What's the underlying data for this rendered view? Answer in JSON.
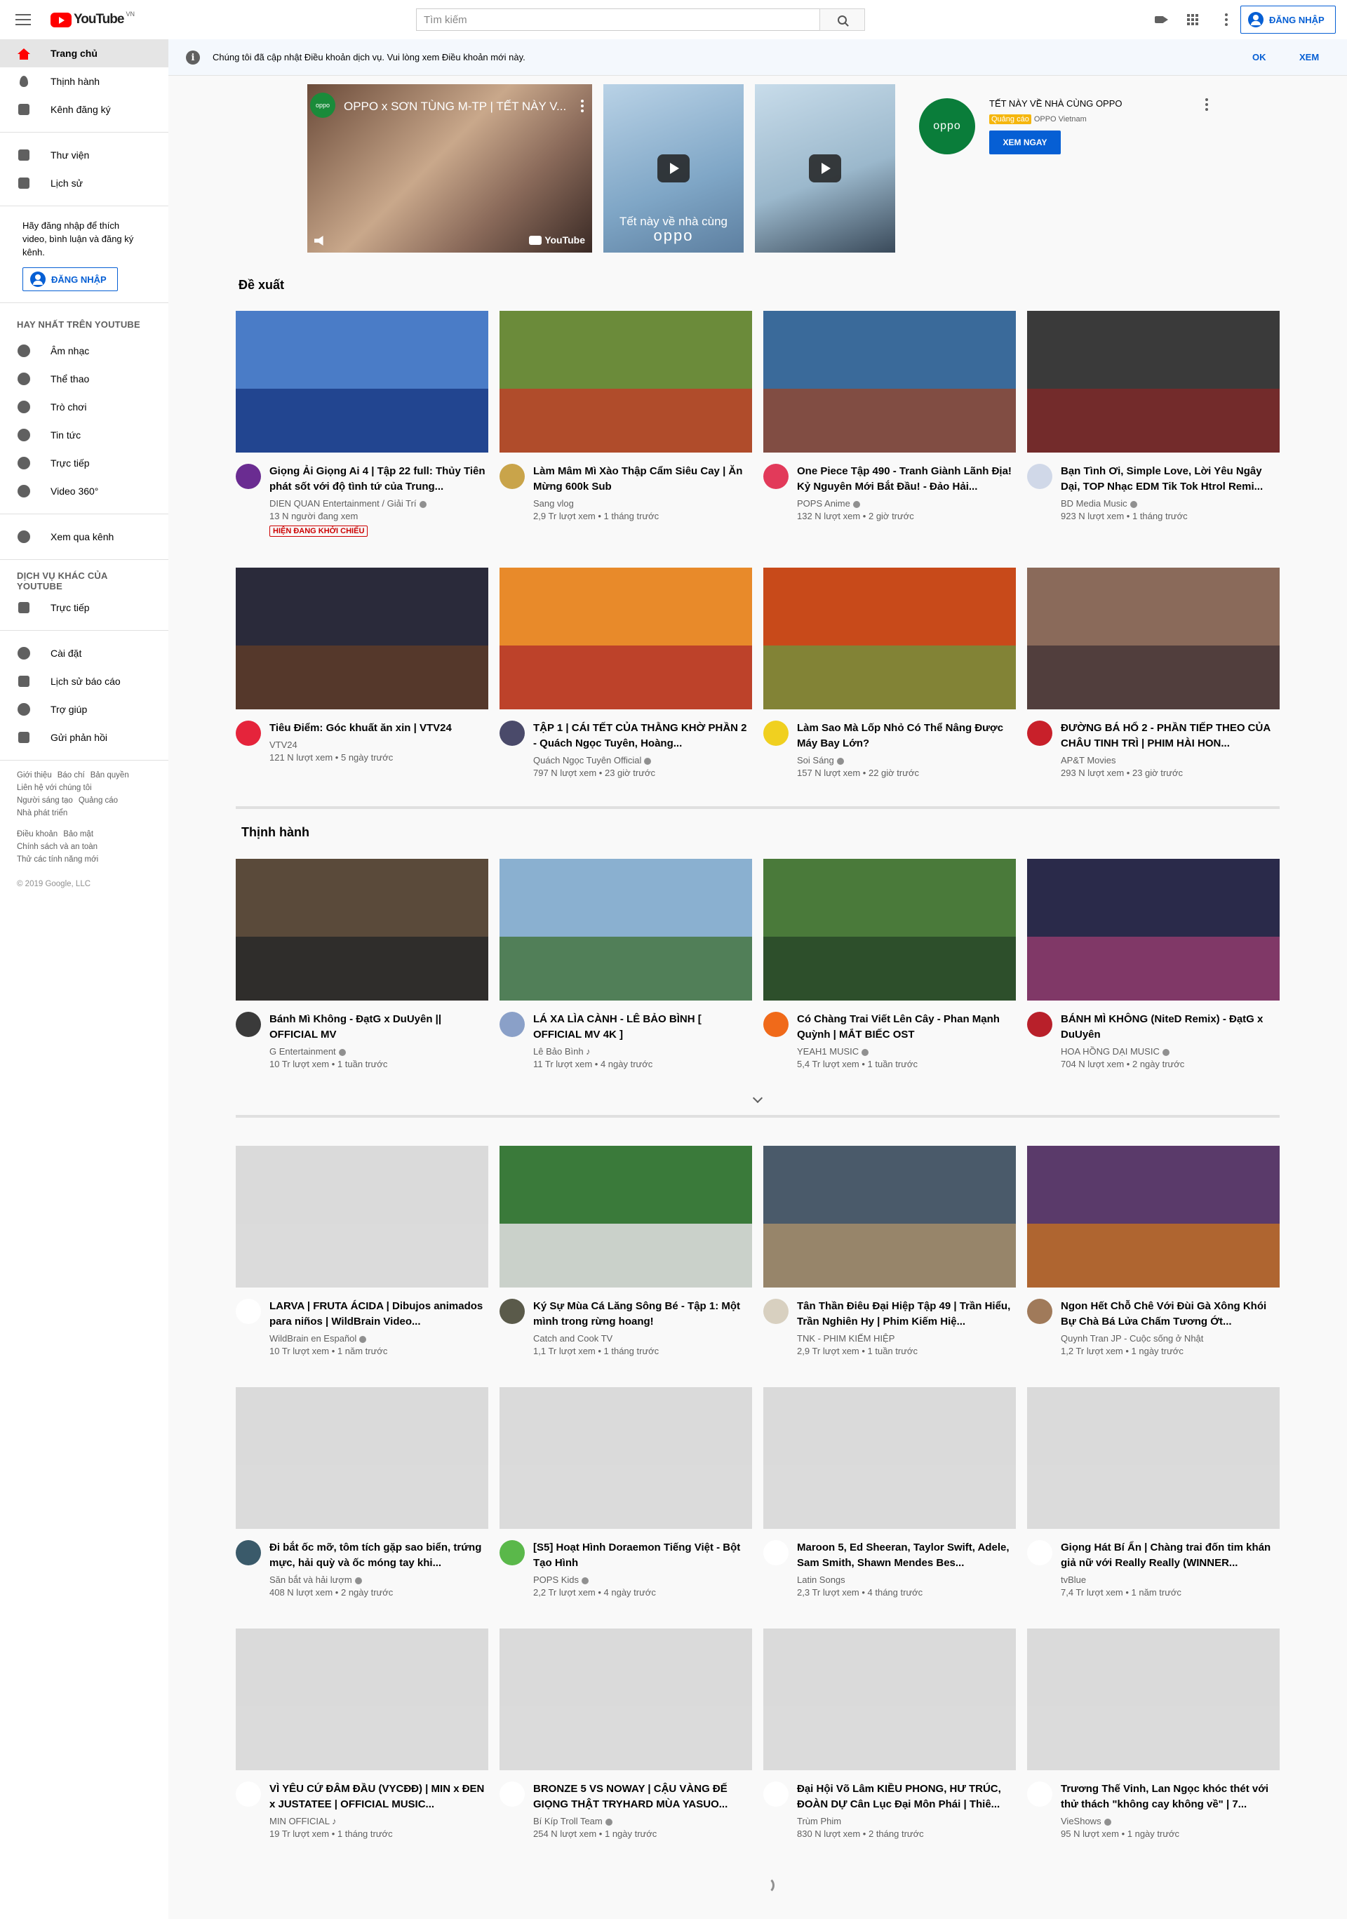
{
  "header": {
    "logo_word": "YouTube",
    "logo_region": "VN",
    "search_placeholder": "Tìm kiếm",
    "sign_in_label": "ĐĂNG NHẬP",
    "icons": [
      "menu-icon",
      "search-icon",
      "create-video-icon",
      "apps-icon",
      "settings-more-icon",
      "account-icon"
    ]
  },
  "sidebar": {
    "main_items": [
      {
        "label": "Trang chủ",
        "icon": "home-icon",
        "active": true
      },
      {
        "label": "Thịnh hành",
        "icon": "trending-icon"
      },
      {
        "label": "Kênh đăng ký",
        "icon": "subscriptions-icon"
      }
    ],
    "library_items": [
      {
        "label": "Thư viện",
        "icon": "library-icon"
      },
      {
        "label": "Lịch sử",
        "icon": "history-icon"
      }
    ],
    "signin_prompt": "Hãy đăng nhập để thích video, bình luận và đăng ký kênh.",
    "signin_label": "ĐĂNG NHẬP",
    "best_heading": "HAY NHẤT TRÊN YOUTUBE",
    "best_items": [
      {
        "label": "Âm nhạc",
        "icon": "music-icon"
      },
      {
        "label": "Thể thao",
        "icon": "sports-icon"
      },
      {
        "label": "Trò chơi",
        "icon": "gaming-icon"
      },
      {
        "label": "Tin tức",
        "icon": "news-icon"
      },
      {
        "label": "Trực tiếp",
        "icon": "live-icon"
      },
      {
        "label": "Video 360°",
        "icon": "video-360-icon"
      }
    ],
    "browse_channels": {
      "label": "Xem qua kênh",
      "icon": "add-circle-icon"
    },
    "more_heading": "DỊCH VỤ KHÁC CỦA YOUTUBE",
    "more_items": [
      {
        "label": "Trực tiếp",
        "icon": "broadcast-icon"
      }
    ],
    "settings_items": [
      {
        "label": "Cài đặt",
        "icon": "settings-icon"
      },
      {
        "label": "Lịch sử báo cáo",
        "icon": "flag-icon"
      },
      {
        "label": "Trợ giúp",
        "icon": "help-icon"
      },
      {
        "label": "Gửi phản hồi",
        "icon": "feedback-icon"
      }
    ],
    "footer_rows_1": [
      [
        "Giới thiệu",
        "Báo chí",
        "Bản quyền"
      ],
      [
        "Liên hệ với chúng tôi"
      ],
      [
        "Người sáng tạo",
        "Quảng cáo"
      ],
      [
        "Nhà phát triển"
      ]
    ],
    "footer_rows_2": [
      [
        "Điều khoản",
        "Bảo mật"
      ],
      [
        "Chính sách và an toàn"
      ],
      [
        "Thử các tính năng mới"
      ]
    ],
    "copyright": "© 2019 Google, LLC"
  },
  "banner": {
    "message": "Chúng tôi đã cập nhật Điều khoản dịch vụ. Vui lòng xem Điều khoản mới này.",
    "ok_label": "OK",
    "view_label": "XEM"
  },
  "ad": {
    "channel_logo_text": "oppo",
    "video_title": "OPPO x SƠN TÙNG M-TP | TẾT NÀY V...",
    "youtube_watermark": "YouTube",
    "thumb2_caption_1": "Tết này về nhà cùng",
    "thumb2_caption_2": "oppo",
    "brand_logo_text": "oppo",
    "title": "TẾT NÀY VỀ NHÀ CÙNG OPPO",
    "ad_badge": "Quảng cáo",
    "advertiser": "OPPO Vietnam",
    "cta_label": "XEM NGAY"
  },
  "sections": {
    "recommended_title": "Đề xuất",
    "trending_title": "Thịnh hành"
  },
  "recommended": [
    {
      "title": "Giọng Ải Giọng Ai 4 | Tập 22 full: Thủy Tiên phát sốt với độ tình tứ của Trung...",
      "channel": "DIEN QUAN Entertainment / Giải Trí",
      "verified": true,
      "stats": "13 N người đang xem",
      "badge": "HIỆN ĐANG KHỞI CHIẾU",
      "avatar": "#6a2c91",
      "thumb": [
        "#4a7cc7",
        "#1e3f8a"
      ]
    },
    {
      "title": "Làm Mâm Mì Xào Thập Cẩm Siêu Cay | Ăn Mừng 600k Sub",
      "channel": "Sang vlog",
      "verified": false,
      "stats": "2,9 Tr lượt xem • 1 tháng trước",
      "avatar": "#c9a44a",
      "thumb": [
        "#6b8b3a",
        "#b8452a"
      ]
    },
    {
      "title": "One Piece Tập 490 - Tranh Giành Lãnh Địa! Kỷ Nguyên Mới Bắt Đầu! - Đảo Hải...",
      "channel": "POPS Anime",
      "verified": true,
      "stats": "132 N lượt xem • 2 giờ trước",
      "avatar": "#e23a5a",
      "thumb": [
        "#3a6a9a",
        "#8a4a3a"
      ]
    },
    {
      "title": "Bạn Tình Ơi, Simple Love, Lời Yêu Ngây Dại, TOP Nhạc EDM Tik Tok Htrol Remi...",
      "channel": "BD Media Music",
      "verified": true,
      "stats": "923 N lượt xem • 1 tháng trước",
      "avatar": "#d0d8e8",
      "thumb": [
        "#3a3a3a",
        "#7a2a2a"
      ]
    },
    {
      "title": "Tiêu Điểm: Góc khuất ăn xin | VTV24",
      "channel": "VTV24",
      "verified": false,
      "stats": "121 N lượt xem • 5 ngày trước",
      "avatar": "#e5243b",
      "thumb": [
        "#2a2a3a",
        "#5a3a2a"
      ]
    },
    {
      "title": "TẬP 1 | CÁI TẾT CỦA THẰNG KHỜ PHẦN 2 - Quách Ngọc Tuyên, Hoàng...",
      "channel": "Quách Ngọc Tuyên Official",
      "verified": true,
      "stats": "797 N lượt xem • 23 giờ trước",
      "avatar": "#4a4a6a",
      "thumb": [
        "#e88a2a",
        "#b83a2a"
      ]
    },
    {
      "title": "Làm Sao Mà Lốp Nhỏ Có Thể Nâng Được Máy Bay Lớn?",
      "channel": "Soi Sáng",
      "verified": true,
      "stats": "157 N lượt xem • 22 giờ trước",
      "avatar": "#f0d020",
      "thumb": [
        "#c84a1a",
        "#7a8a3a"
      ]
    },
    {
      "title": "ĐƯỜNG BÁ HỔ 2 - PHẦN TIẾP THEO CỦA CHÂU TINH TRÌ | PHIM HÀI HON...",
      "channel": "AP&T Movies",
      "verified": false,
      "stats": "293 N lượt xem • 23 giờ trước",
      "avatar": "#c8202a",
      "thumb": [
        "#8a6a5a",
        "#4a3a3a"
      ]
    }
  ],
  "trending": [
    {
      "title": "Bánh Mì Không - ĐạtG x DuUyên || OFFICIAL MV",
      "channel": "G Entertainment",
      "verified": true,
      "stats": "10 Tr lượt xem • 1 tuần trước",
      "avatar": "#3a3a3a",
      "thumb": [
        "#5a4a3a",
        "#2a2a2a"
      ]
    },
    {
      "title": "LÁ XA LÌA CÀNH - LÊ BẢO BÌNH [ OFFICIAL MV 4K ]",
      "channel": "Lê Bảo Bình",
      "verified": false,
      "music_note": true,
      "stats": "11 Tr lượt xem • 4 ngày trước",
      "avatar": "#8aa0c8",
      "thumb": [
        "#8ab0d0",
        "#4a7a4a"
      ]
    },
    {
      "title": "Có Chàng Trai Viết Lên Cây - Phan Mạnh Quỳnh | MẮT BIẾC OST",
      "channel": "YEAH1 MUSIC",
      "verified": true,
      "stats": "5,4 Tr lượt xem • 1 tuần trước",
      "avatar": "#f06a1a",
      "thumb": [
        "#4a7a3a",
        "#2a4a2a"
      ]
    },
    {
      "title": "BÁNH MÌ KHÔNG (NiteD Remix) - ĐạtG x DuUyên",
      "channel": "HOA HỒNG DẠI MUSIC",
      "verified": true,
      "stats": "704 N lượt xem • 2 ngày trước",
      "avatar": "#b8202a",
      "thumb": [
        "#2a2a4a",
        "#8a3a6a"
      ]
    }
  ],
  "more_videos": [
    {
      "title": "LARVA | FRUTA ÁCIDA | Dibujos animados para niños | WildBrain Video...",
      "channel": "WildBrain en Español",
      "verified": true,
      "stats": "10 Tr lượt xem • 1 năm trước",
      "avatar": "#ffffff",
      "thumb": [
        "#dadada",
        "#dadada"
      ]
    },
    {
      "title": "Ký Sự Mùa Cá Lăng Sông Bé - Tập 1: Một mình trong rừng hoang!",
      "channel": "Catch and Cook TV",
      "verified": false,
      "stats": "1,1 Tr lượt xem • 1 tháng trước",
      "avatar": "#5a5a4a",
      "thumb": [
        "#3a7a3a",
        "#dadada"
      ]
    },
    {
      "title": "Tân Thần Điêu Đại Hiệp Tập 49 | Trần Hiểu, Trần Nghiên Hy | Phim Kiếm Hiệ...",
      "channel": "TNK - PHIM KIẾM HIỆP",
      "verified": false,
      "stats": "2,9 Tr lượt xem • 1 tuần trước",
      "avatar": "#d8d0c0",
      "thumb": [
        "#4a5a6a",
        "#a08a6a"
      ]
    },
    {
      "title": "Ngon Hết Chỗ Chê Với Đùi Gà Xông Khói Bự Chà Bá Lửa Chấm Tương Ớt...",
      "channel": "Quynh Tran JP - Cuộc sống ở Nhật",
      "verified": false,
      "stats": "1,2 Tr lượt xem • 1 ngày trước",
      "avatar": "#a07a5a",
      "thumb": [
        "#5a3a6a",
        "#b86a2a"
      ]
    },
    {
      "title": "Đi bắt ốc mỡ, tôm tích gặp sao biển, trứng mực, hải quỳ và ốc móng tay khi...",
      "channel": "Săn bắt và hải lượm",
      "verified": true,
      "stats": "408 N lượt xem • 2 ngày trước",
      "avatar": "#3a5a6a",
      "thumb": [
        "#dadada",
        "#dadada"
      ]
    },
    {
      "title": "[S5] Hoạt Hình Doraemon Tiếng Việt - Bột Tạo Hình",
      "channel": "POPS Kids",
      "verified": true,
      "stats": "2,2 Tr lượt xem • 4 ngày trước",
      "avatar": "#5ab84a",
      "thumb": [
        "#dadada",
        "#dadada"
      ]
    },
    {
      "title": "Maroon 5, Ed Sheeran, Taylor Swift, Adele, Sam Smith, Shawn Mendes Bes...",
      "channel": "Latin Songs",
      "verified": false,
      "stats": "2,3 Tr lượt xem • 4 tháng trước",
      "avatar": "#ffffff",
      "thumb": [
        "#dadada",
        "#dadada"
      ]
    },
    {
      "title": "Giọng Hát Bí Ẩn | Chàng trai đốn tim khán giả nữ với Really Really (WINNER...",
      "channel": "tvBlue",
      "verified": false,
      "stats": "7,4 Tr lượt xem • 1 năm trước",
      "avatar": "#ffffff",
      "thumb": [
        "#dadada",
        "#dadada"
      ]
    },
    {
      "title": "VÌ YÊU CỨ ĐÂM ĐẦU (VYCĐĐ) | MIN x ĐEN x JUSTATEE | OFFICIAL MUSIC...",
      "channel": "MIN OFFICIAL",
      "verified": false,
      "music_note": true,
      "stats": "19 Tr lượt xem • 1 tháng trước",
      "avatar": "#ffffff",
      "thumb": [
        "#dadada",
        "#dadada"
      ]
    },
    {
      "title": "BRONZE 5 VS NOWAY | CẬU VÀNG ĐẾ GIỌNG THẬT TRYHARD MÙA YASUO...",
      "channel": "Bí Kíp Troll Team",
      "verified": true,
      "stats": "254 N lượt xem • 1 ngày trước",
      "avatar": "#ffffff",
      "thumb": [
        "#dadada",
        "#dadada"
      ]
    },
    {
      "title": "Đại Hội Võ Lâm KIỀU PHONG, HƯ TRÚC, ĐOÀN DỰ Cân Lục Đại Môn Phái | Thiê...",
      "channel": "Trùm Phim",
      "verified": false,
      "stats": "830 N lượt xem • 2 tháng trước",
      "avatar": "#ffffff",
      "thumb": [
        "#dadada",
        "#dadada"
      ]
    },
    {
      "title": "Trương Thế Vinh, Lan Ngọc khóc thét với thử thách \"không cay không về\" | 7...",
      "channel": "VieShows",
      "verified": true,
      "stats": "95 N lượt xem • 1 ngày trước",
      "avatar": "#ffffff",
      "thumb": [
        "#dadada",
        "#dadada"
      ]
    }
  ]
}
